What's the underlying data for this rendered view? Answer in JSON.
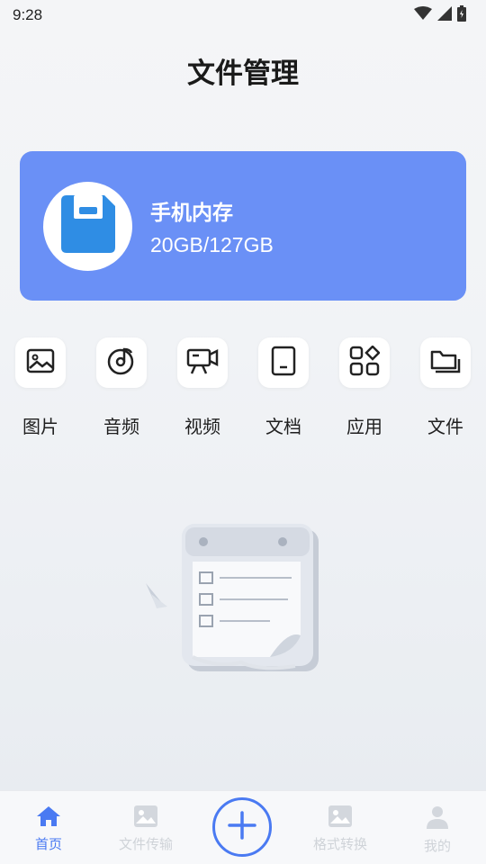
{
  "status_bar": {
    "time": "9:28",
    "icons": [
      "wifi-icon",
      "signal-icon",
      "battery-icon"
    ]
  },
  "header": {
    "title": "文件管理"
  },
  "storage": {
    "label": "手机内存",
    "value": "20GB/127GB",
    "icon": "floppy-disk-icon",
    "accent": "#6a90f6"
  },
  "categories": [
    {
      "label": "图片",
      "icon": "image-icon"
    },
    {
      "label": "音频",
      "icon": "music-disc-icon"
    },
    {
      "label": "视频",
      "icon": "video-camera-icon"
    },
    {
      "label": "文档",
      "icon": "document-icon"
    },
    {
      "label": "应用",
      "icon": "apps-grid-icon"
    },
    {
      "label": "文件",
      "icon": "folder-icon"
    }
  ],
  "tab_bar": {
    "active_color": "#4a7af2",
    "inactive_color": "#cfd3d8",
    "items": [
      {
        "label": "首页",
        "icon": "home-icon",
        "active": true
      },
      {
        "label": "文件传输",
        "icon": "image-icon",
        "active": false
      },
      {
        "label": "",
        "icon": "plus-icon",
        "active": false
      },
      {
        "label": "格式转换",
        "icon": "image-icon",
        "active": false
      },
      {
        "label": "我的",
        "icon": "person-icon",
        "active": false
      }
    ]
  }
}
